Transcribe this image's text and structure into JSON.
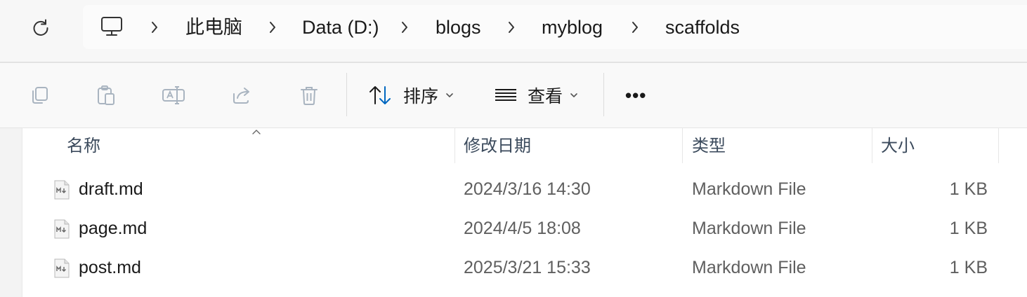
{
  "address": {
    "breadcrumbs": [
      "此电脑",
      "Data (D:)",
      "blogs",
      "myblog",
      "scaffolds"
    ],
    "root_icon": "computer-icon",
    "refresh_icon": "refresh-icon"
  },
  "toolbar": {
    "icons": [
      "copy-icon",
      "paste-icon",
      "rename-icon",
      "share-icon",
      "delete-icon"
    ],
    "sort_label": "排序",
    "view_label": "查看",
    "more_label": "•••"
  },
  "columns": {
    "name": "名称",
    "date": "修改日期",
    "type": "类型",
    "size": "大小"
  },
  "files": [
    {
      "name": "draft.md",
      "date": "2024/3/16 14:30",
      "type": "Markdown File",
      "size": "1 KB"
    },
    {
      "name": "page.md",
      "date": "2024/4/5 18:08",
      "type": "Markdown File",
      "size": "1 KB"
    },
    {
      "name": "post.md",
      "date": "2025/3/21 15:33",
      "type": "Markdown File",
      "size": "1 KB"
    }
  ],
  "colors": {
    "accent": "#0067c0",
    "disabled_icon": "#a9b4c0"
  }
}
